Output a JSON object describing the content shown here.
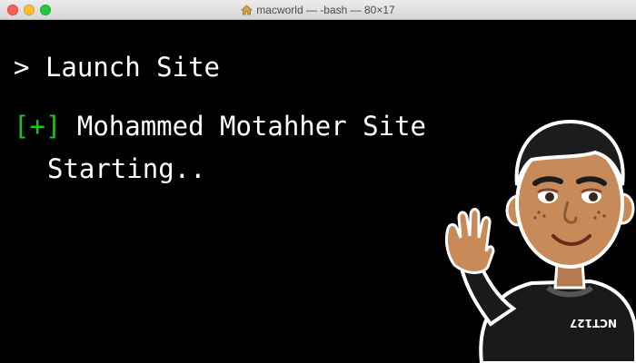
{
  "window": {
    "title": "macworld — -bash — 80×17"
  },
  "terminal": {
    "prompt_symbol": ">",
    "command": "Launch Site",
    "status_marker": "[+]",
    "message_line1": "Mohammed Motahher Site",
    "message_line2": "Starting.."
  },
  "avatar": {
    "shirt_text": "NCT127"
  },
  "colors": {
    "background": "#000000",
    "text": "#ffffff",
    "status_marker": "#1ec21e"
  }
}
